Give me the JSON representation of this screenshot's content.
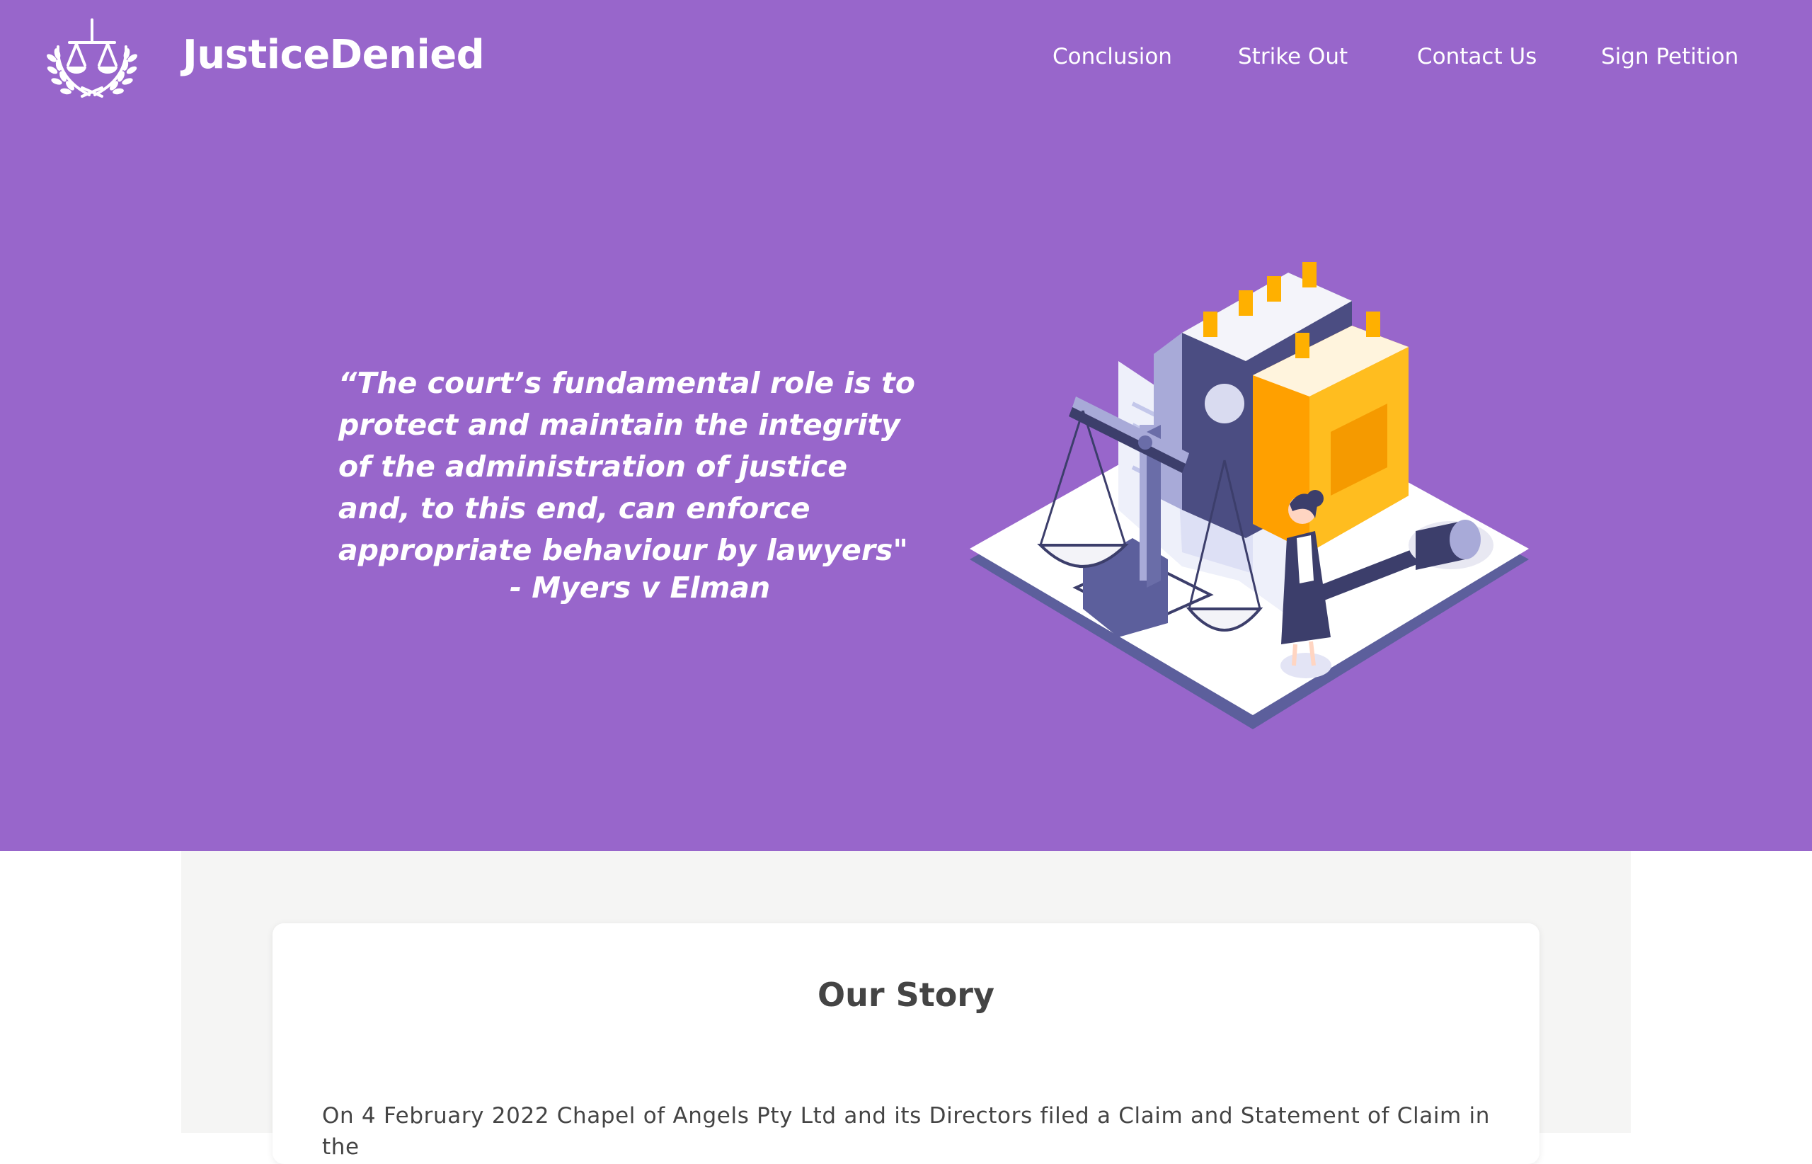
{
  "header": {
    "brand": "JusticeDenied",
    "logo_icon": "scales-laurel-icon",
    "nav": [
      {
        "label": "Conclusion"
      },
      {
        "label": "Strike Out"
      },
      {
        "label": "Contact Us"
      },
      {
        "label": "Sign Petition"
      }
    ]
  },
  "hero": {
    "quote": "“The court’s fundamental role is to protect and maintain the integrity of the administration of justice and, to this end, can enforce appropriate behaviour by lawyers\"",
    "author": "- Myers v Elman",
    "illustration_icon": "justice-scales-books-illustration",
    "background_color": "#9866cb"
  },
  "story": {
    "title": "Our Story",
    "first_line": "On 4 February 2022 Chapel of Angels Pty Ltd and its Directors filed a Claim and Statement of Claim in the"
  }
}
